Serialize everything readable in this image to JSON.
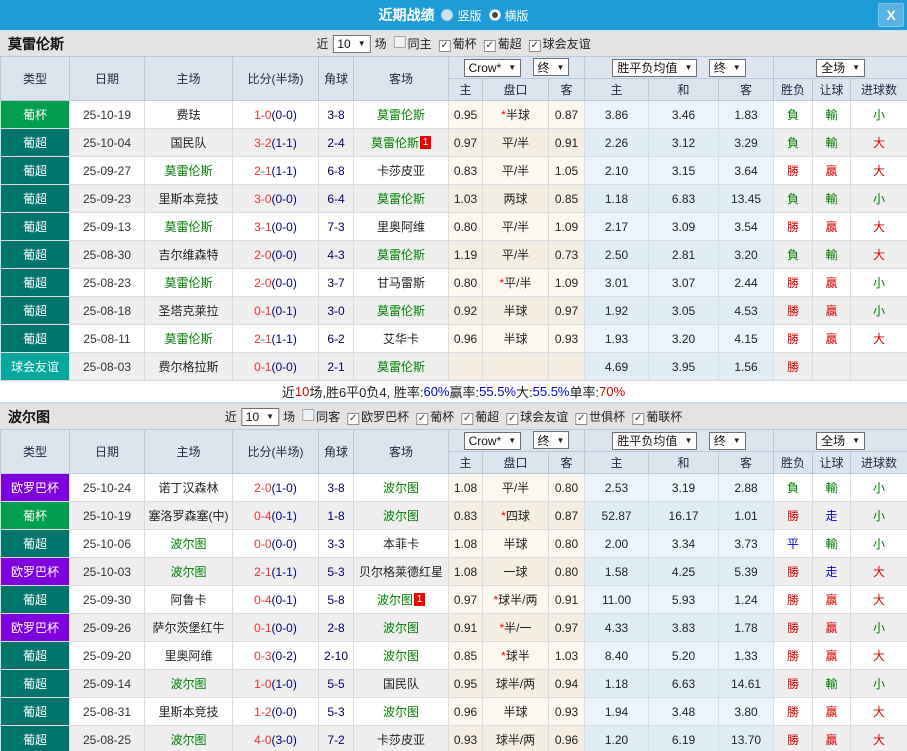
{
  "titlebar": {
    "title": "近期战绩",
    "radios": [
      {
        "label": "竖版",
        "selected": false
      },
      {
        "label": "横版",
        "selected": true
      }
    ],
    "close_label": "X"
  },
  "controls": {
    "near_label": "近",
    "games_value": "10",
    "games_suffix": "场",
    "odds_company": "Crow*",
    "final_label": "终",
    "avg_label": "胜平负均值",
    "scope_label": "全场"
  },
  "headers": {
    "main": [
      "类型",
      "日期",
      "主场",
      "比分(半场)",
      "角球",
      "客场"
    ],
    "sub": [
      "主",
      "盘口",
      "客",
      "主",
      "和",
      "客",
      "胜负",
      "让球",
      "进球数"
    ]
  },
  "type_colors": {
    "葡杯": "#009e4e",
    "葡超": "#00756b",
    "球会友谊": "#00a89c",
    "欧罗巴杯": "#7d00dd"
  },
  "sections": [
    {
      "team": "莫雷伦斯",
      "checkboxes": [
        {
          "label": "同主",
          "checked": false
        },
        {
          "label": "葡杯",
          "checked": true
        },
        {
          "label": "葡超",
          "checked": true
        },
        {
          "label": "球会友谊",
          "checked": true
        }
      ],
      "rows": [
        {
          "type": "葡杯",
          "date": "25-10-19",
          "home": "费珐",
          "home_hl": false,
          "home_badge": "",
          "score": "1-0",
          "half": "(0-0)",
          "corners": "3-8",
          "away": "莫雷伦斯",
          "away_hl": true,
          "away_badge": "",
          "o1": "0.95",
          "hc_star": true,
          "hc": "半球",
          "o2": "0.87",
          "a1": "3.86",
          "a2": "3.46",
          "a3": "1.83",
          "r1": "負",
          "r1c": "green",
          "r2": "輸",
          "r2c": "green",
          "r3": "小",
          "r3c": "green"
        },
        {
          "type": "葡超",
          "date": "25-10-04",
          "home": "国民队",
          "home_hl": false,
          "home_badge": "",
          "score": "3-2",
          "half": "(1-1)",
          "corners": "2-4",
          "away": "莫雷伦斯",
          "away_hl": true,
          "away_badge": "1",
          "o1": "0.97",
          "hc_star": false,
          "hc": "平/半",
          "o2": "0.91",
          "a1": "2.26",
          "a2": "3.12",
          "a3": "3.29",
          "r1": "負",
          "r1c": "green",
          "r2": "輸",
          "r2c": "green",
          "r3": "大",
          "r3c": "red"
        },
        {
          "type": "葡超",
          "date": "25-09-27",
          "home": "莫雷伦斯",
          "home_hl": true,
          "home_badge": "",
          "score": "2-1",
          "half": "(1-1)",
          "corners": "6-8",
          "away": "卡莎皮亚",
          "away_hl": false,
          "away_badge": "",
          "o1": "0.83",
          "hc_star": false,
          "hc": "平/半",
          "o2": "1.05",
          "a1": "2.10",
          "a2": "3.15",
          "a3": "3.64",
          "r1": "勝",
          "r1c": "red",
          "r2": "贏",
          "r2c": "red",
          "r3": "大",
          "r3c": "red"
        },
        {
          "type": "葡超",
          "date": "25-09-23",
          "home": "里斯本竞技",
          "home_hl": false,
          "home_badge": "",
          "score": "3-0",
          "half": "(0-0)",
          "corners": "6-4",
          "away": "莫雷伦斯",
          "away_hl": true,
          "away_badge": "",
          "o1": "1.03",
          "hc_star": false,
          "hc": "两球",
          "o2": "0.85",
          "a1": "1.18",
          "a2": "6.83",
          "a3": "13.45",
          "r1": "負",
          "r1c": "green",
          "r2": "輸",
          "r2c": "green",
          "r3": "小",
          "r3c": "green"
        },
        {
          "type": "葡超",
          "date": "25-09-13",
          "home": "莫雷伦斯",
          "home_hl": true,
          "home_badge": "",
          "score": "3-1",
          "half": "(0-0)",
          "corners": "7-3",
          "away": "里奥阿维",
          "away_hl": false,
          "away_badge": "",
          "o1": "0.80",
          "hc_star": false,
          "hc": "平/半",
          "o2": "1.09",
          "a1": "2.17",
          "a2": "3.09",
          "a3": "3.54",
          "r1": "勝",
          "r1c": "red",
          "r2": "贏",
          "r2c": "red",
          "r3": "大",
          "r3c": "red"
        },
        {
          "type": "葡超",
          "date": "25-08-30",
          "home": "吉尔维森特",
          "home_hl": false,
          "home_badge": "",
          "score": "2-0",
          "half": "(0-0)",
          "corners": "4-3",
          "away": "莫雷伦斯",
          "away_hl": true,
          "away_badge": "",
          "o1": "1.19",
          "hc_star": false,
          "hc": "平/半",
          "o2": "0.73",
          "a1": "2.50",
          "a2": "2.81",
          "a3": "3.20",
          "r1": "負",
          "r1c": "green",
          "r2": "輸",
          "r2c": "green",
          "r3": "大",
          "r3c": "red"
        },
        {
          "type": "葡超",
          "date": "25-08-23",
          "home": "莫雷伦斯",
          "home_hl": true,
          "home_badge": "",
          "score": "2-0",
          "half": "(0-0)",
          "corners": "3-7",
          "away": "甘马雷斯",
          "away_hl": false,
          "away_badge": "",
          "o1": "0.80",
          "hc_star": true,
          "hc": "平/半",
          "o2": "1.09",
          "a1": "3.01",
          "a2": "3.07",
          "a3": "2.44",
          "r1": "勝",
          "r1c": "red",
          "r2": "贏",
          "r2c": "red",
          "r3": "小",
          "r3c": "green"
        },
        {
          "type": "葡超",
          "date": "25-08-18",
          "home": "圣塔克莱拉",
          "home_hl": false,
          "home_badge": "",
          "score": "0-1",
          "half": "(0-1)",
          "corners": "3-0",
          "away": "莫雷伦斯",
          "away_hl": true,
          "away_badge": "",
          "o1": "0.92",
          "hc_star": false,
          "hc": "半球",
          "o2": "0.97",
          "a1": "1.92",
          "a2": "3.05",
          "a3": "4.53",
          "r1": "勝",
          "r1c": "red",
          "r2": "贏",
          "r2c": "red",
          "r3": "小",
          "r3c": "green"
        },
        {
          "type": "葡超",
          "date": "25-08-11",
          "home": "莫雷伦斯",
          "home_hl": true,
          "home_badge": "",
          "score": "2-1",
          "half": "(1-1)",
          "corners": "6-2",
          "away": "艾华卡",
          "away_hl": false,
          "away_badge": "",
          "o1": "0.96",
          "hc_star": false,
          "hc": "半球",
          "o2": "0.93",
          "a1": "1.93",
          "a2": "3.20",
          "a3": "4.15",
          "r1": "勝",
          "r1c": "red",
          "r2": "贏",
          "r2c": "red",
          "r3": "大",
          "r3c": "red"
        },
        {
          "type": "球会友谊",
          "date": "25-08-03",
          "home": "费尔格拉斯",
          "home_hl": false,
          "home_badge": "",
          "score": "0-1",
          "half": "(0-0)",
          "corners": "2-1",
          "away": "莫雷伦斯",
          "away_hl": true,
          "away_badge": "",
          "o1": "",
          "hc_star": false,
          "hc": "",
          "o2": "",
          "a1": "4.69",
          "a2": "3.95",
          "a3": "1.56",
          "r1": "勝",
          "r1c": "red",
          "r2": "",
          "r2c": "",
          "r3": "",
          "r3c": ""
        }
      ],
      "summary": [
        {
          "text": "近",
          "color": ""
        },
        {
          "text": "10",
          "color": "red"
        },
        {
          "text": "场,胜6平0负4, 胜率:",
          "color": ""
        },
        {
          "text": "60%",
          "color": "blue"
        },
        {
          "text": " 赢率:",
          "color": ""
        },
        {
          "text": "55.5%",
          "color": "blue"
        },
        {
          "text": " 大:",
          "color": ""
        },
        {
          "text": "55.5%",
          "color": "blue"
        },
        {
          "text": " 单率:",
          "color": ""
        },
        {
          "text": "70%",
          "color": "red"
        }
      ]
    },
    {
      "team": "波尔图",
      "checkboxes": [
        {
          "label": "同客",
          "checked": false
        },
        {
          "label": "欧罗巴杯",
          "checked": true
        },
        {
          "label": "葡杯",
          "checked": true
        },
        {
          "label": "葡超",
          "checked": true
        },
        {
          "label": "球会友谊",
          "checked": true
        },
        {
          "label": "世俱杯",
          "checked": true
        },
        {
          "label": "葡联杯",
          "checked": true
        }
      ],
      "rows": [
        {
          "type": "欧罗巴杯",
          "date": "25-10-24",
          "home": "诺丁汉森林",
          "home_hl": false,
          "home_badge": "",
          "score": "2-0",
          "half": "(1-0)",
          "corners": "3-8",
          "away": "波尔图",
          "away_hl": true,
          "away_badge": "",
          "o1": "1.08",
          "hc_star": false,
          "hc": "平/半",
          "o2": "0.80",
          "a1": "2.53",
          "a2": "3.19",
          "a3": "2.88",
          "r1": "負",
          "r1c": "green",
          "r2": "輸",
          "r2c": "green",
          "r3": "小",
          "r3c": "green"
        },
        {
          "type": "葡杯",
          "date": "25-10-19",
          "home": "塞洛罗森塞(中)",
          "home_hl": false,
          "home_badge": "",
          "score": "0-4",
          "half": "(0-1)",
          "corners": "1-8",
          "away": "波尔图",
          "away_hl": true,
          "away_badge": "",
          "o1": "0.83",
          "hc_star": true,
          "hc": "四球",
          "o2": "0.87",
          "a1": "52.87",
          "a2": "16.17",
          "a3": "1.01",
          "r1": "勝",
          "r1c": "red",
          "r2": "走",
          "r2c": "blue",
          "r3": "小",
          "r3c": "green"
        },
        {
          "type": "葡超",
          "date": "25-10-06",
          "home": "波尔图",
          "home_hl": true,
          "home_badge": "",
          "score": "0-0",
          "half": "(0-0)",
          "corners": "3-3",
          "away": "本菲卡",
          "away_hl": false,
          "away_badge": "",
          "o1": "1.08",
          "hc_star": false,
          "hc": "半球",
          "o2": "0.80",
          "a1": "2.00",
          "a2": "3.34",
          "a3": "3.73",
          "r1": "平",
          "r1c": "blue",
          "r2": "輸",
          "r2c": "green",
          "r3": "小",
          "r3c": "green"
        },
        {
          "type": "欧罗巴杯",
          "date": "25-10-03",
          "home": "波尔图",
          "home_hl": true,
          "home_badge": "",
          "score": "2-1",
          "half": "(1-1)",
          "corners": "5-3",
          "away": "贝尔格莱德红星",
          "away_hl": false,
          "away_badge": "",
          "o1": "1.08",
          "hc_star": false,
          "hc": "一球",
          "o2": "0.80",
          "a1": "1.58",
          "a2": "4.25",
          "a3": "5.39",
          "r1": "勝",
          "r1c": "red",
          "r2": "走",
          "r2c": "blue",
          "r3": "大",
          "r3c": "red"
        },
        {
          "type": "葡超",
          "date": "25-09-30",
          "home": "阿鲁卡",
          "home_hl": false,
          "home_badge": "",
          "score": "0-4",
          "half": "(0-1)",
          "corners": "5-8",
          "away": "波尔图",
          "away_hl": true,
          "away_badge": "1",
          "o1": "0.97",
          "hc_star": true,
          "hc": "球半/两",
          "o2": "0.91",
          "a1": "11.00",
          "a2": "5.93",
          "a3": "1.24",
          "r1": "勝",
          "r1c": "red",
          "r2": "贏",
          "r2c": "red",
          "r3": "大",
          "r3c": "red"
        },
        {
          "type": "欧罗巴杯",
          "date": "25-09-26",
          "home": "萨尔茨堡红牛",
          "home_hl": false,
          "home_badge": "",
          "score": "0-1",
          "half": "(0-0)",
          "corners": "2-8",
          "away": "波尔图",
          "away_hl": true,
          "away_badge": "",
          "o1": "0.91",
          "hc_star": true,
          "hc": "半/一",
          "o2": "0.97",
          "a1": "4.33",
          "a2": "3.83",
          "a3": "1.78",
          "r1": "勝",
          "r1c": "red",
          "r2": "贏",
          "r2c": "red",
          "r3": "小",
          "r3c": "green"
        },
        {
          "type": "葡超",
          "date": "25-09-20",
          "home": "里奥阿维",
          "home_hl": false,
          "home_badge": "",
          "score": "0-3",
          "half": "(0-2)",
          "corners": "2-10",
          "away": "波尔图",
          "away_hl": true,
          "away_badge": "",
          "o1": "0.85",
          "hc_star": true,
          "hc": "球半",
          "o2": "1.03",
          "a1": "8.40",
          "a2": "5.20",
          "a3": "1.33",
          "r1": "勝",
          "r1c": "red",
          "r2": "贏",
          "r2c": "red",
          "r3": "大",
          "r3c": "red"
        },
        {
          "type": "葡超",
          "date": "25-09-14",
          "home": "波尔图",
          "home_hl": true,
          "home_badge": "",
          "score": "1-0",
          "half": "(1-0)",
          "corners": "5-5",
          "away": "国民队",
          "away_hl": false,
          "away_badge": "",
          "o1": "0.95",
          "hc_star": false,
          "hc": "球半/两",
          "o2": "0.94",
          "a1": "1.18",
          "a2": "6.63",
          "a3": "14.61",
          "r1": "勝",
          "r1c": "red",
          "r2": "輸",
          "r2c": "green",
          "r3": "小",
          "r3c": "green"
        },
        {
          "type": "葡超",
          "date": "25-08-31",
          "home": "里斯本竞技",
          "home_hl": false,
          "home_badge": "",
          "score": "1-2",
          "half": "(0-0)",
          "corners": "5-3",
          "away": "波尔图",
          "away_hl": true,
          "away_badge": "",
          "o1": "0.96",
          "hc_star": false,
          "hc": "半球",
          "o2": "0.93",
          "a1": "1.94",
          "a2": "3.48",
          "a3": "3.80",
          "r1": "勝",
          "r1c": "red",
          "r2": "贏",
          "r2c": "red",
          "r3": "大",
          "r3c": "red"
        },
        {
          "type": "葡超",
          "date": "25-08-25",
          "home": "波尔图",
          "home_hl": true,
          "home_badge": "",
          "score": "4-0",
          "half": "(3-0)",
          "corners": "7-2",
          "away": "卡莎皮亚",
          "away_hl": false,
          "away_badge": "",
          "o1": "0.93",
          "hc_star": false,
          "hc": "球半/两",
          "o2": "0.96",
          "a1": "1.20",
          "a2": "6.19",
          "a3": "13.70",
          "r1": "勝",
          "r1c": "red",
          "r2": "贏",
          "r2c": "red",
          "r3": "大",
          "r3c": "red"
        }
      ],
      "summary": []
    }
  ]
}
